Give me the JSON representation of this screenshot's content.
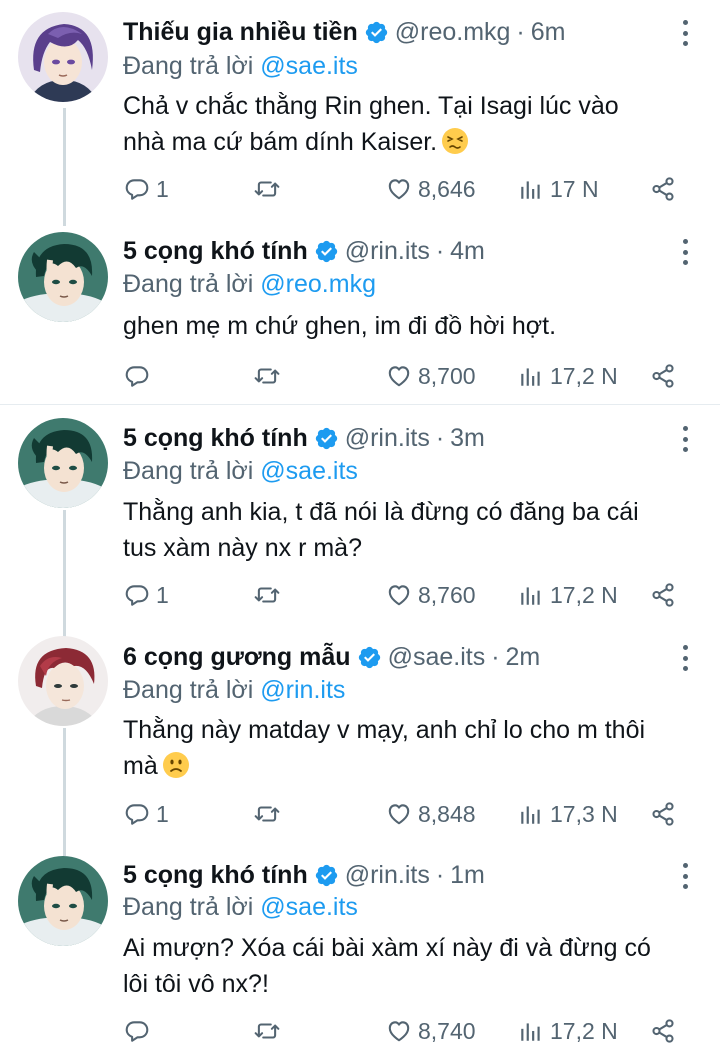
{
  "verified_color": "#1d9bf0",
  "reply_prefix": "Đang trả lời",
  "tweets": [
    {
      "name": "Thiếu gia nhiều tiền",
      "handle": "@reo.mkg",
      "time": "6m",
      "reply_to": "@sae.its",
      "line1": "Chả v chắc thằng Rin ghen. Tại Isagi lúc vào",
      "line2": "nhà ma cứ bám dính Kaiser.",
      "emoji": "persevering-face",
      "replies": "1",
      "likes": "8,646",
      "views": "17 N",
      "avatar": "purple-hair-avatar"
    },
    {
      "name": "5 cọng khó tính",
      "handle": "@rin.its",
      "time": "4m",
      "reply_to": "@reo.mkg",
      "line1": "ghen mẹ m chứ ghen, im đi đồ hời hợt.",
      "line2": "",
      "replies": "",
      "likes": "8,700",
      "views": "17,2 N",
      "avatar": "dark-green-hair-avatar"
    },
    {
      "name": "5 cọng khó tính",
      "handle": "@rin.its",
      "time": "3m",
      "reply_to": "@sae.its",
      "line1": "Thằng anh kia, t đã nói là đừng có đăng ba cái",
      "line2": "tus xàm này nx r mà?",
      "replies": "1",
      "likes": "8,760",
      "views": "17,2 N",
      "avatar": "dark-green-hair-avatar"
    },
    {
      "name": "6 cọng gương mẫu",
      "handle": "@sae.its",
      "time": "2m",
      "reply_to": "@rin.its",
      "line1": "Thằng này matday v mạy, anh chỉ lo cho m thôi",
      "line2": "mà",
      "emoji": "slightly-frowning-face",
      "replies": "1",
      "likes": "8,848",
      "views": "17,3 N",
      "avatar": "red-hair-avatar"
    },
    {
      "name": "5 cọng khó tính",
      "handle": "@rin.its",
      "time": "1m",
      "reply_to": "@sae.its",
      "line1": "Ai mượn? Xóa cái bài xàm xí này đi và đừng có",
      "line2": "lôi tôi vô nx?!",
      "replies": "",
      "likes": "8,740",
      "views": "17,2 N",
      "avatar": "dark-green-hair-avatar"
    }
  ]
}
